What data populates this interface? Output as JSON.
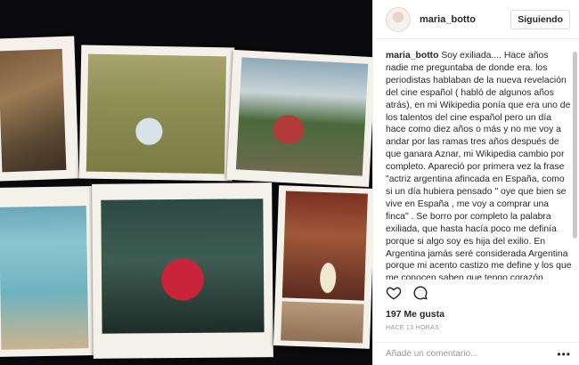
{
  "post": {
    "username": "maria_botto",
    "follow_label": "Siguiendo",
    "caption_user": "maria_botto",
    "caption_text": "Soy exiliada.... Hace años nadie me preguntaba de donde era. los periodistas hablaban de la nueva revelación del cine español ( habló de algunos años atrás), en mi Wikipedia ponía que era uno de los talentos del cine español pero un día hace como diez años o más y no me voy a andar por las ramas tres años después de que ganara Aznar, mi Wikipedia cambio por completo. Apareció por primera vez la frase \"actriz argentina afincada en España, como si un día hubiera pensado \" oye que bien se vive en España , me voy a comprar una finca\" . Se borro por completo la palabra exiliada, que hasta hacía poco me definía porque si algo soy es hija del exilio. En Argentina jamás seré considerada Argentina porque mi acento castizo me define y los que me conocen saben que tengo corazón macarra porque",
    "likes": "197 Me gusta",
    "time_ago": "HACE 13 HORAS",
    "comment_placeholder": "Añade un comentario...",
    "more_label": "•••"
  },
  "icons": {
    "like": "heart-outline-icon",
    "comment": "speech-bubble-icon",
    "more": "ellipsis-icon"
  },
  "colors": {
    "border": "#efefef",
    "text": "#262626",
    "muted": "#999999",
    "photo_bg": "#0b0b0d"
  }
}
